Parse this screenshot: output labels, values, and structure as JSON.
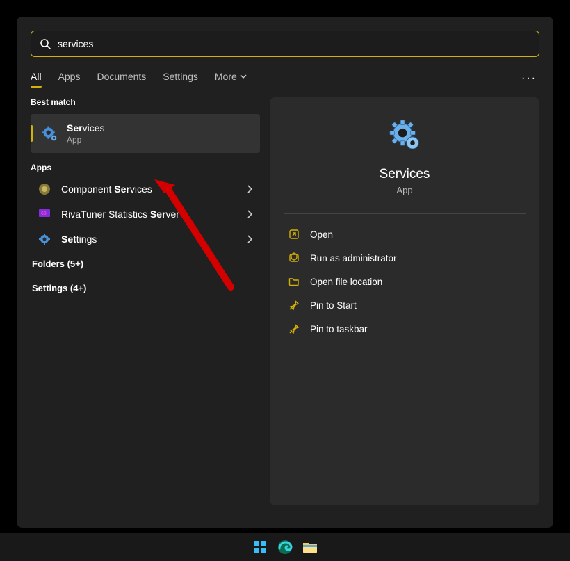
{
  "search": {
    "query": "services",
    "prefix": "ser",
    "suffix": "vices"
  },
  "tabs": [
    "All",
    "Apps",
    "Documents",
    "Settings",
    "More"
  ],
  "sections": {
    "bestMatch": "Best match",
    "apps": "Apps"
  },
  "bestMatch": {
    "titlePrefix": "Ser",
    "titleSuffix": "vices",
    "sub": "App"
  },
  "appsList": [
    {
      "prefix": "Component ",
      "bold": "Ser",
      "suffix": "vices"
    },
    {
      "prefix": "RivaTuner Statistics ",
      "bold": "Ser",
      "suffix": "ver"
    },
    {
      "prefix": "",
      "bold": "Set",
      "suffix": "tings"
    }
  ],
  "expandRows": {
    "folders": "Folders (5+)",
    "settings": "Settings (4+)"
  },
  "detail": {
    "title": "Services",
    "sub": "App",
    "actions": [
      "Open",
      "Run as administrator",
      "Open file location",
      "Pin to Start",
      "Pin to taskbar"
    ]
  }
}
